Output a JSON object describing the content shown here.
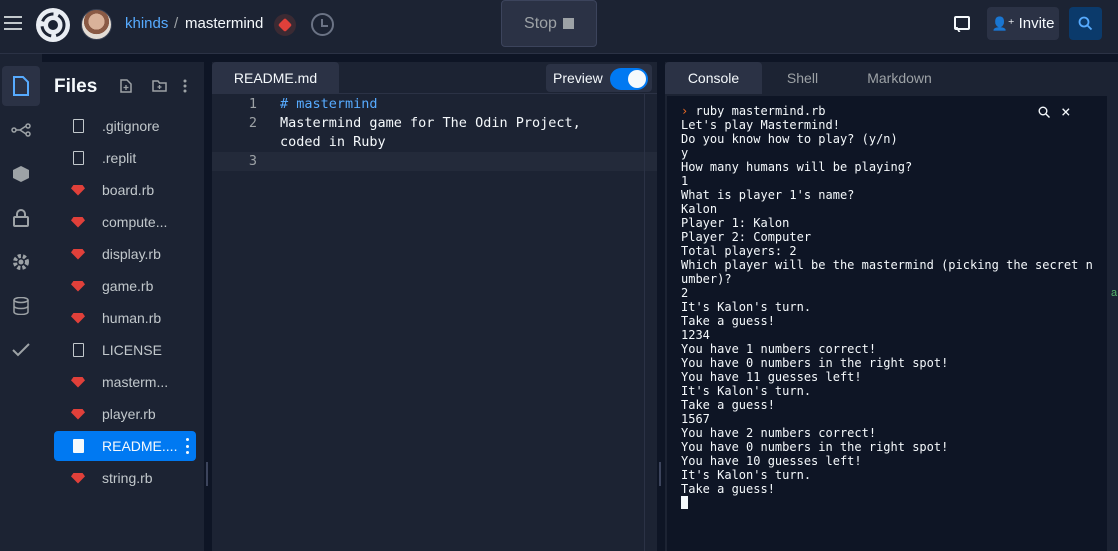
{
  "header": {
    "user": "khinds",
    "separator": "/",
    "repl_name": "mastermind",
    "stop_label": "Stop",
    "invite_label": "Invite"
  },
  "rail": {
    "icons": [
      "files-icon",
      "git-icon",
      "packages-icon",
      "secrets-icon",
      "settings-icon",
      "database-icon",
      "unit-tests-icon"
    ]
  },
  "files": {
    "title": "Files",
    "items": [
      {
        "name": ".gitignore",
        "kind": "doc"
      },
      {
        "name": ".replit",
        "kind": "doc"
      },
      {
        "name": "board.rb",
        "kind": "ruby"
      },
      {
        "name": "compute...",
        "kind": "ruby"
      },
      {
        "name": "display.rb",
        "kind": "ruby"
      },
      {
        "name": "game.rb",
        "kind": "ruby"
      },
      {
        "name": "human.rb",
        "kind": "ruby"
      },
      {
        "name": "LICENSE",
        "kind": "doc"
      },
      {
        "name": "masterm...",
        "kind": "ruby"
      },
      {
        "name": "player.rb",
        "kind": "ruby"
      },
      {
        "name": "README....",
        "kind": "doc",
        "selected": true
      },
      {
        "name": "string.rb",
        "kind": "ruby"
      }
    ]
  },
  "editor": {
    "tab": "README.md",
    "preview_label": "Preview",
    "preview_on": true,
    "line_numbers": [
      "1",
      "2",
      "",
      "3"
    ],
    "lines": [
      "# mastermind",
      "Mastermind game for The Odin Project,",
      "coded in Ruby",
      ""
    ]
  },
  "right": {
    "tabs": [
      "Console",
      "Shell",
      "Markdown"
    ],
    "active_tab": "Console",
    "command": "ruby mastermind.rb",
    "output": [
      "Let's play Mastermind!",
      "Do you know how to play? (y/n)",
      "y",
      "How many humans will be playing?",
      "1",
      "What is player 1's name?",
      "Kalon",
      "Player 1: Kalon",
      "Player 2: Computer",
      "Total players: 2",
      "Which player will be the mastermind (picking the secret n",
      "umber)?",
      "2",
      "It's Kalon's turn.",
      "Take a guess!",
      "1234",
      "You have 1 numbers correct!",
      "You have 0 numbers in the right spot!",
      "You have 11 guesses left!",
      "It's Kalon's turn.",
      "Take a guess!",
      "1567",
      "You have 2 numbers correct!",
      "You have 0 numbers in the right spot!",
      "You have 10 guesses left!",
      "It's Kalon's turn.",
      "Take a guess!"
    ]
  },
  "colors": {
    "accent": "#0079f2",
    "link": "#57abff",
    "ruby": "#e0403a"
  }
}
